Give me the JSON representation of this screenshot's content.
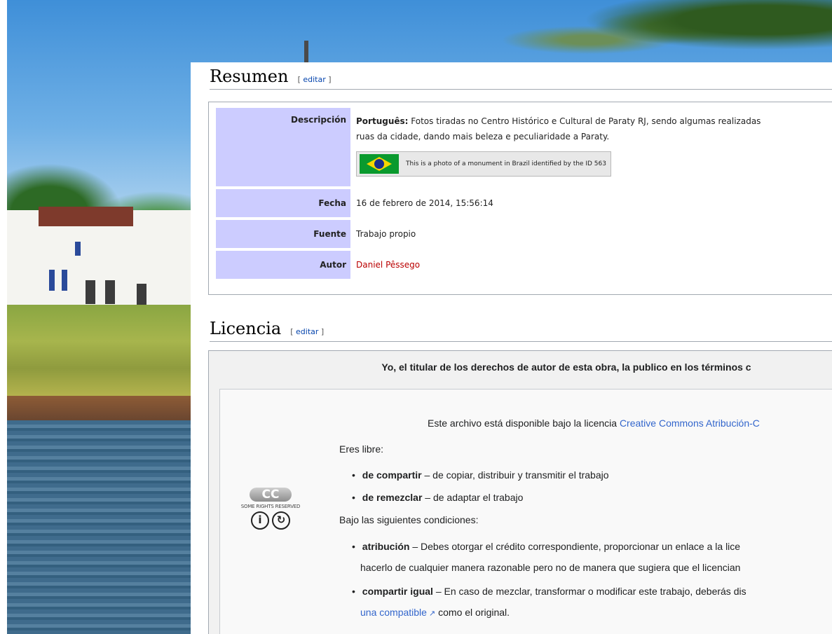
{
  "summary": {
    "heading": "Resumen",
    "edit_link": "editar",
    "rows": {
      "descripcion": {
        "label": "Descripción",
        "lang": "Português:",
        "text_line1": "Fotos tiradas no Centro Histórico e Cultural de Paraty RJ, sendo algumas realizadas",
        "text_line2": "ruas da cidade, dando mais beleza e peculiaridade a Paraty.",
        "monument_text": "This is a photo of a monument in Brazil identified by the ID 563"
      },
      "fecha": {
        "label": "Fecha",
        "value": "16 de febrero de 2014, 15:56:14"
      },
      "fuente": {
        "label": "Fuente",
        "value": "Trabajo propio"
      },
      "autor": {
        "label": "Autor",
        "value": "Daniel Pêssego"
      }
    }
  },
  "license": {
    "heading": "Licencia",
    "edit_link": "editar",
    "header_text": "Yo, el titular de los derechos de autor de esta obra, la publico en los términos c",
    "available_prefix": "Este archivo está disponible bajo la licencia",
    "available_link": "Creative Commons Atribución-C",
    "free_title": "Eres libre:",
    "free_items": [
      {
        "term": "de compartir",
        "desc": " – de copiar, distribuir y transmitir el trabajo"
      },
      {
        "term": "de remezclar",
        "desc": " – de adaptar el trabajo"
      }
    ],
    "conditions_title": "Bajo las siguientes condiciones:",
    "conditions": [
      {
        "term": "atribución",
        "desc_line1": " – Debes otorgar el crédito correspondiente, proporcionar un enlace a la lice",
        "desc_line2": "hacerlo de cualquier manera razonable pero no de manera que sugiera que el licencian"
      },
      {
        "term": "compartir igual",
        "desc_line1": " – En caso de mezclar, transformar o modificar este trabajo, deberás dis",
        "link": "una compatible",
        "desc_line2_suffix": " como el original."
      }
    ],
    "cc_logo": {
      "text": "CC",
      "rights": "SOME RIGHTS RESERVED",
      "icons": [
        "attribution-icon",
        "share-alike-icon"
      ]
    }
  },
  "colors": {
    "label_bg": "#ccccff",
    "author_link": "#ba0000",
    "link": "#3366cc",
    "license_bg": "#f1f1f1"
  }
}
